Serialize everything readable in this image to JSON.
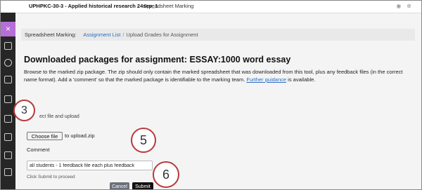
{
  "header": {
    "course_title": "UPHPKC-30-3 - Applied historical research 24sep_1",
    "tool_title": "Spreadsheet Marking"
  },
  "rail": {
    "close_glyph": "×"
  },
  "breadcrumb": {
    "label": "Spreadsheet Marking:",
    "link": "Assignment List",
    "separator": "/",
    "current": "Upload Grades for Assignment"
  },
  "page": {
    "title": "Downloaded packages for assignment: ESSAY:1000 word essay",
    "description_before": "Browse to the marked zip package. The zip should only contain the marked spreadsheet that was downloaded from this tool, plus any feedback files (in the correct name format). Add a 'comment' so that the marked package is identifiable to the marking team.",
    "guidance_link": "Further guidance",
    "description_after": "is available."
  },
  "form": {
    "section_label": "ect file and upload",
    "choose_file_label": "Choose file",
    "file_name": "to upload.zip",
    "comment_label": "Comment",
    "comment_value": "all students - 1 feedback file each plus feedback",
    "hint": "Click Submit to proceed",
    "cancel_label": "Cancel",
    "submit_label": "Submit"
  },
  "callouts": {
    "step3": "3",
    "step5": "5",
    "step6": "6"
  },
  "colors": {
    "accent": "#b56fd6",
    "link": "#2a6cc4",
    "callout_border": "#b83a3a"
  }
}
